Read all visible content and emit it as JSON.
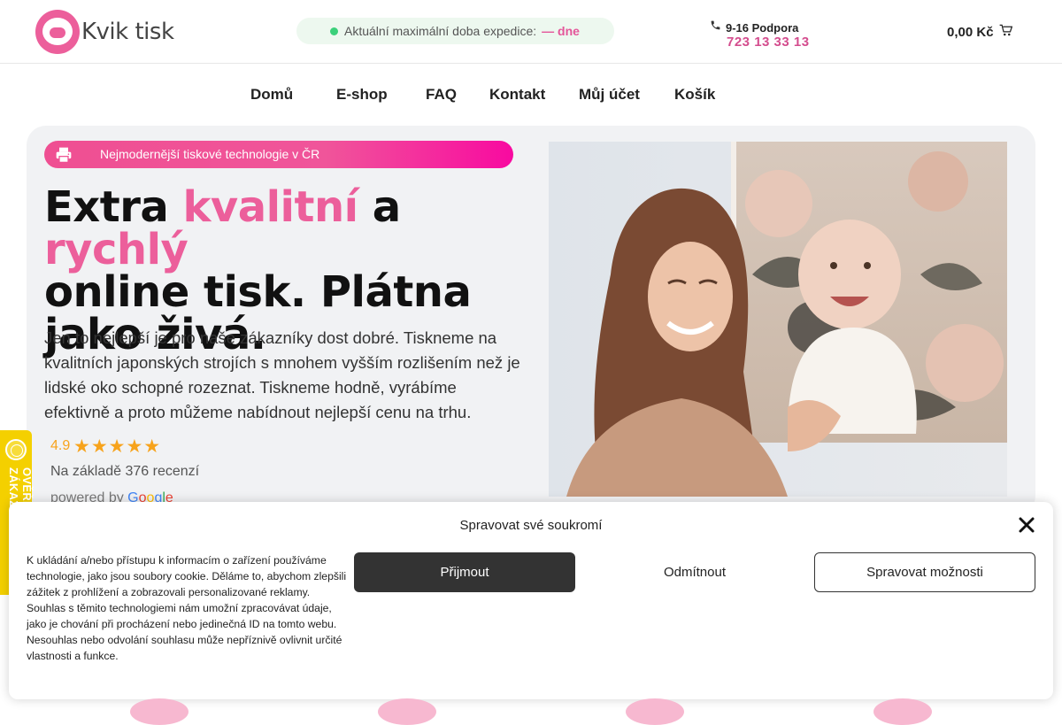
{
  "header": {
    "logo_text": "Kvik tisk",
    "expedice": {
      "label": "Aktuální maximální doba expedice:",
      "value": "— dne"
    },
    "support": {
      "title": "9-16 Podpora",
      "phone": "723 13 33 13"
    },
    "cart_total": "0,00 Kč"
  },
  "nav": [
    "Domů",
    "E-shop",
    "FAQ",
    "Kontakt",
    "Můj účet",
    "Košík"
  ],
  "hero": {
    "pill_text": "Nejmodernější tiskové technologie v ČR",
    "headline": {
      "w1": "Extra",
      "w2": "kvalitní",
      "w3": "a",
      "w4": "rychlý",
      "line2": "online tisk. Plátna",
      "line3": "jako živá."
    },
    "lead": "Jen to nejlepší je pro naše zákazníky dost dobré. Tiskneme na kvalitních japonských strojích s  mnohem vyšším rozlišením než je lidské oko schopné rozeznat. Tiskneme hodně, vyrábíme efektivně a proto můžeme nabídnout nejlepší cenu na trhu.",
    "rating": {
      "score": "4.9",
      "stars": 5,
      "based_on": "Na základě 376 recenzí",
      "powered_by": "powered by",
      "google": [
        "G",
        "o",
        "o",
        "g",
        "l",
        "e"
      ]
    }
  },
  "badge": {
    "text": "OVĚŘENO ZÁKAZNÍKY"
  },
  "cookie": {
    "title": "Spravovat své soukromí",
    "text": "K ukládání a/nebo přístupu k informacím o zařízení používáme technologie, jako jsou soubory cookie. Děláme to, abychom zlepšili zážitek z prohlížení a zobrazovali personalizované reklamy. Souhlas s těmito technologiemi nám umožní zpracovávat údaje, jako je chování při procházení nebo jedinečná ID na tomto webu. Nesouhlas nebo odvolání souhlasu může nepříznivě ovlivnit určité vlastnosti a funkce.",
    "accept": "Přijmout",
    "deny": "Odmítnout",
    "manage": "Spravovat možnosti"
  },
  "colors": {
    "brand_pink": "#ec5f9b",
    "star": "#f7a31c",
    "badge": "#f4d000",
    "status_green": "#3bd07a"
  },
  "icons": {
    "phone": "phone-icon",
    "cart": "cart-icon",
    "printer": "printer-icon",
    "close": "close-icon",
    "seal": "verified-seal-icon"
  }
}
